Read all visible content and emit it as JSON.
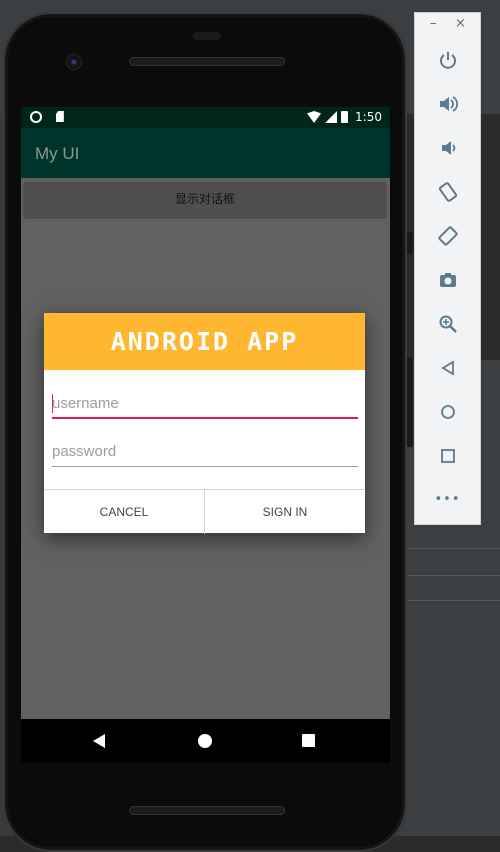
{
  "app": {
    "title": "My UI"
  },
  "status_bar": {
    "time": "1:50"
  },
  "main": {
    "show_dialog_button": "显示对话框"
  },
  "dialog": {
    "header_text": "ANDROID APP",
    "username_placeholder": "username",
    "password_placeholder": "password",
    "cancel_label": "CANCEL",
    "sign_in_label": "SIGN IN"
  },
  "emulator_toolbar": {
    "window_minimize": "–",
    "window_close": "×",
    "more": "•••"
  },
  "colors": {
    "app_bar": "#00332a",
    "status_bar": "#00251a",
    "dialog_header": "#ffb630",
    "focus_accent": "#d81b60"
  }
}
